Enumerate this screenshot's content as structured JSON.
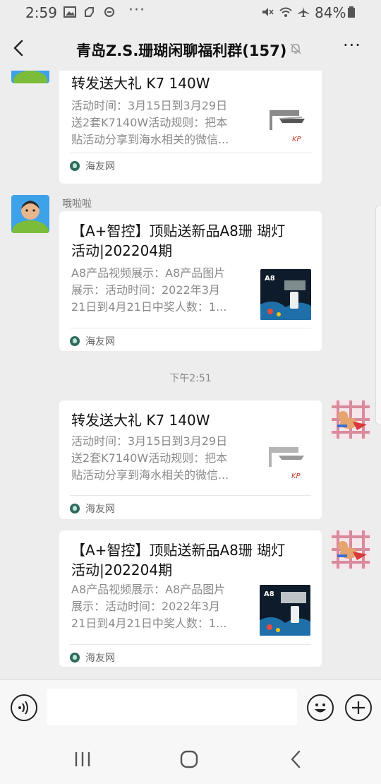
{
  "status_bar": {
    "time": "2:59",
    "dots": "···",
    "battery": "84%"
  },
  "header": {
    "title": "青岛Z.S.珊瑚闲聊福利群(157)",
    "more": "···"
  },
  "messages": [
    {
      "card_title": "转发送大礼  K7 140W",
      "desc_lines": [
        "活动时间：3月15日到3月29日",
        "送2套K7140W活动规则：把本",
        "贴活动分享到海水相关的微信..."
      ],
      "source": "海友网"
    },
    {
      "sender": "哦啦啦",
      "card_title_lines": [
        "【A+智控】顶贴送新品A8珊 瑚灯",
        "活动|202204期"
      ],
      "desc_lines": [
        "A8产品视频展示：A8产品图片",
        "展示：活动时间：2022年3月",
        "21日到4月21日中奖人数：1..."
      ],
      "source": "海友网"
    },
    {
      "card_title": "转发送大礼  K7 140W",
      "desc_lines": [
        "活动时间：3月15日到3月29日",
        "送2套K7140W活动规则：把本",
        "贴活动分享到海水相关的微信..."
      ],
      "source": "海友网"
    },
    {
      "card_title_lines": [
        "【A+智控】顶贴送新品A8珊 瑚灯",
        "活动|202204期"
      ],
      "desc_lines": [
        "A8产品视频展示：A8产品图片",
        "展示：活动时间：2022年3月",
        "21日到4月21日中奖人数：1..."
      ],
      "source": "海友网"
    }
  ],
  "timestamp": "下午2:51",
  "thumbnails": {
    "k7_brand": "KP",
    "a8_brand": "A8"
  },
  "icons": [
    "gallery-icon",
    "notification-icon",
    "mute-icon",
    "wifi-icon",
    "airplane-icon",
    "battery-icon",
    "back-icon",
    "muted-bell-icon",
    "voice-icon",
    "emoji-icon",
    "plus-icon",
    "recent-apps-icon",
    "home-icon",
    "nav-back-icon"
  ],
  "colors": {
    "background": "#ededed",
    "card": "#ffffff",
    "source_logo": "#2e6b5c"
  }
}
